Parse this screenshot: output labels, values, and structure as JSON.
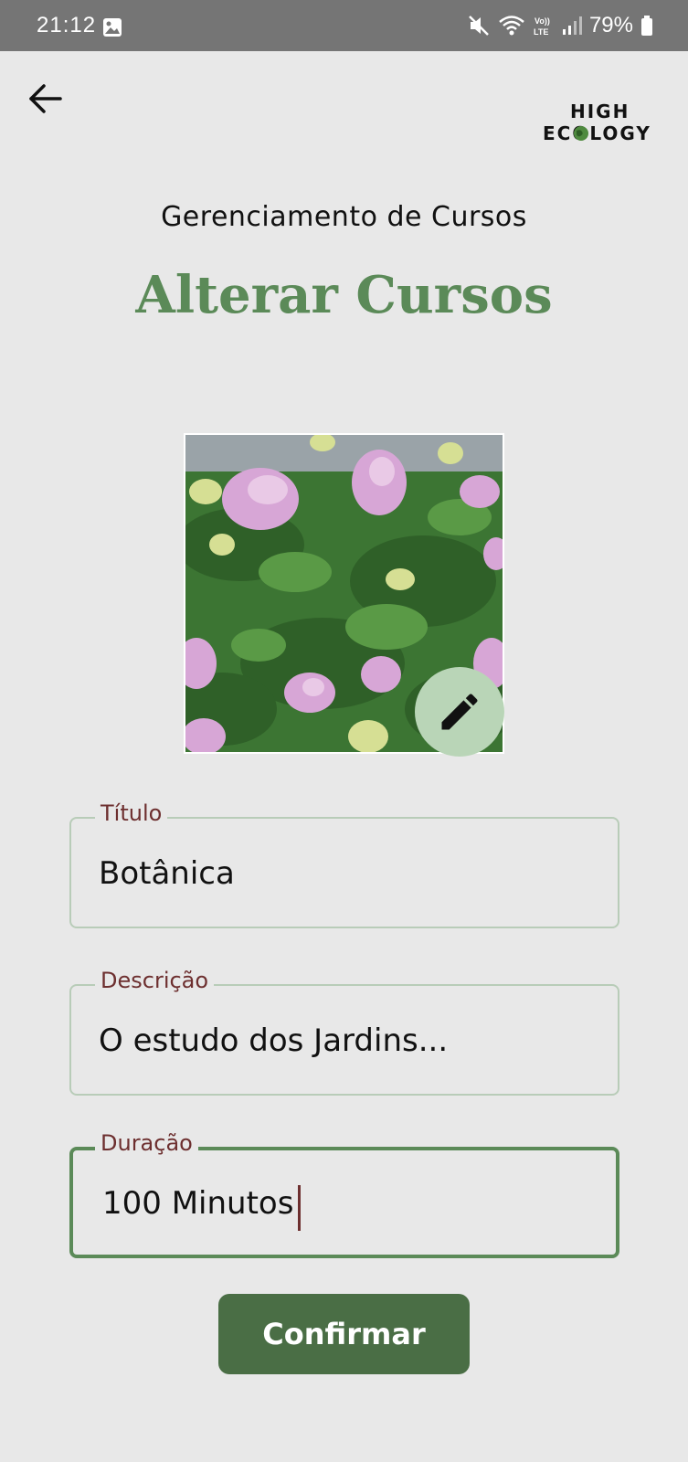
{
  "status_bar": {
    "time": "21:12",
    "battery": "79%",
    "network": "LTE",
    "icons": [
      "gallery-icon",
      "mute-icon",
      "wifi-icon",
      "volte-icon",
      "signal-icon",
      "battery-icon"
    ]
  },
  "header": {
    "back_icon": "arrow-left-icon",
    "logo_line1": "HIGH",
    "logo_line2": "ECOLOGY"
  },
  "page": {
    "subtitle": "Gerenciamento de Cursos",
    "title": "Alterar Cursos"
  },
  "image": {
    "subject": "hydrangea-bush-photo",
    "edit_icon": "pencil-icon"
  },
  "form": {
    "fields": [
      {
        "label": "Título",
        "value": "Botânica"
      },
      {
        "label": "Descrição",
        "value": "O estudo dos Jardins..."
      },
      {
        "label": "Duração",
        "value": "100 Minutos"
      }
    ],
    "confirm_label": "Confirmar"
  },
  "colors": {
    "background": "#e8e8e8",
    "status_bar": "#757575",
    "accent_green": "#5b8a58",
    "button_green": "#4a6e45",
    "label_maroon": "#6d2f2f",
    "edit_circle": "#b9d5b7"
  }
}
